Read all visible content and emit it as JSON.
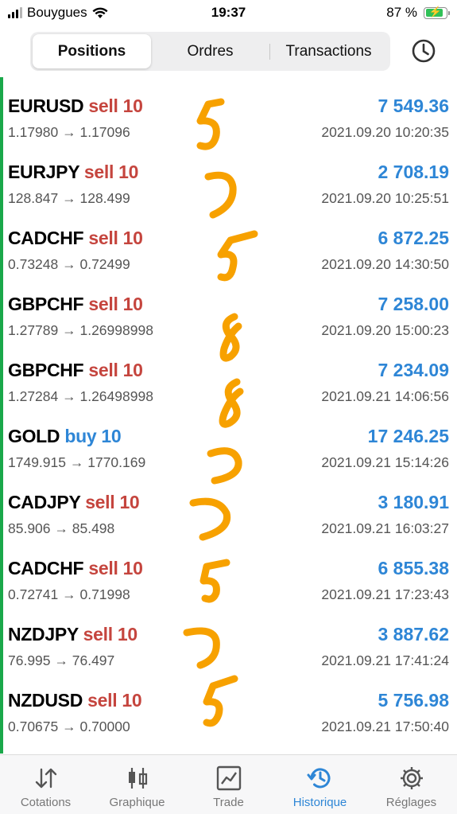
{
  "status_bar": {
    "carrier": "Bouygues",
    "time": "19:37",
    "battery_percent": "87 %",
    "battery_level": 0.87,
    "signal_bars": 3
  },
  "segment": {
    "tabs": [
      {
        "label": "Positions",
        "active": true
      },
      {
        "label": "Ordres",
        "active": false
      },
      {
        "label": "Transactions",
        "active": false
      }
    ]
  },
  "header": {
    "history_icon": "clock-icon"
  },
  "colors": {
    "accent": "#2e86d6",
    "sell": "#c5453e",
    "buy": "#2e86d6",
    "scribble": "#f7a100",
    "position_bar": "#1aa84a"
  },
  "positions": [
    {
      "symbol": "EURUSD",
      "side": "sell",
      "volume": "sell 10",
      "prices": "1.17980 → 1.17096",
      "profit": "7 549.36",
      "time": "2021.09.20 10:20:35"
    },
    {
      "symbol": "EURJPY",
      "side": "sell",
      "volume": "sell 10",
      "prices": "128.847 → 128.499",
      "profit": "2 708.19",
      "time": "2021.09.20 10:25:51"
    },
    {
      "symbol": "CADCHF",
      "side": "sell",
      "volume": "sell 10",
      "prices": "0.73248 → 0.72499",
      "profit": "6 872.25",
      "time": "2021.09.20 14:30:50"
    },
    {
      "symbol": "GBPCHF",
      "side": "sell",
      "volume": "sell 10",
      "prices": "1.27789 → 1.26998998",
      "profit": "7 258.00",
      "time": "2021.09.20 15:00:23"
    },
    {
      "symbol": "GBPCHF",
      "side": "sell",
      "volume": "sell 10",
      "prices": "1.27284 → 1.26498998",
      "profit": "7 234.09",
      "time": "2021.09.21 14:06:56"
    },
    {
      "symbol": "GOLD",
      "side": "buy",
      "volume": "buy 10",
      "prices": "1749.915 → 1770.169",
      "profit": "17 246.25",
      "time": "2021.09.21 15:14:26"
    },
    {
      "symbol": "CADJPY",
      "side": "sell",
      "volume": "sell 10",
      "prices": "85.906 → 85.498",
      "profit": "3 180.91",
      "time": "2021.09.21 16:03:27"
    },
    {
      "symbol": "CADCHF",
      "side": "sell",
      "volume": "sell 10",
      "prices": "0.72741 → 0.71998",
      "profit": "6 855.38",
      "time": "2021.09.21 17:23:43"
    },
    {
      "symbol": "NZDJPY",
      "side": "sell",
      "volume": "sell 10",
      "prices": "76.995 → 76.497",
      "profit": "3 887.62",
      "time": "2021.09.21 17:41:24"
    },
    {
      "symbol": "NZDUSD",
      "side": "sell",
      "volume": "sell 10",
      "prices": "0.70675 → 0.70000",
      "profit": "5 756.98",
      "time": "2021.09.21 17:50:40"
    }
  ],
  "tabbar": {
    "items": [
      {
        "label": "Cotations",
        "icon": "sort-arrows-icon",
        "active": false
      },
      {
        "label": "Graphique",
        "icon": "candlestick-icon",
        "active": false
      },
      {
        "label": "Trade",
        "icon": "trade-chart-icon",
        "active": false
      },
      {
        "label": "Historique",
        "icon": "history-icon",
        "active": true
      },
      {
        "label": "Réglages",
        "icon": "gear-icon",
        "active": false
      }
    ]
  }
}
